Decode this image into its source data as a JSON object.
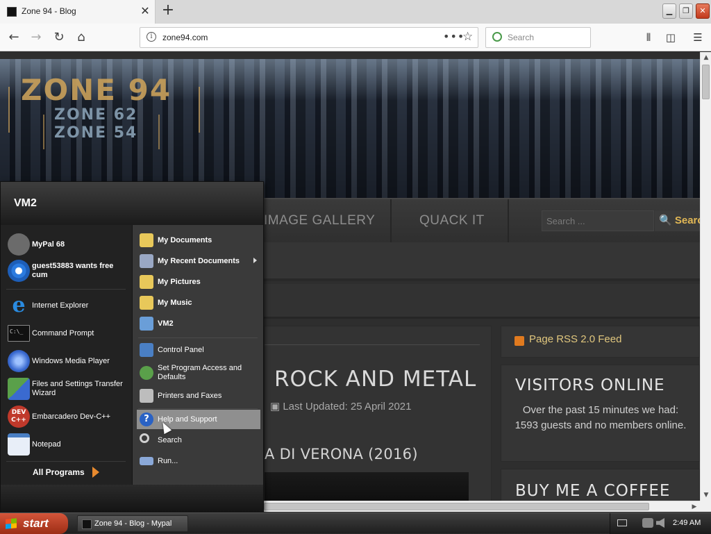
{
  "browser": {
    "tab_title": "Zone 94 - Blog",
    "new_tab_symbol": "+",
    "url": "zone94.com",
    "search_placeholder": "Search",
    "url_actions": "•••",
    "bookmark_star": "☆"
  },
  "site": {
    "logo": {
      "main": "ZONE 94",
      "sub1": "ZONE 62",
      "sub2": "ZONE 54"
    },
    "menu": [
      "IMAGE GALLERY",
      "QUACK IT"
    ],
    "search_placeholder": "Search ...",
    "search_button": "Search",
    "article": {
      "title": "ROCK AND METAL",
      "date": "Last Updated: 25 April 2021",
      "subtitle": "A DI VERONA (2016)"
    },
    "sidebar": {
      "rss": "Page RSS 2.0 Feed",
      "visitors_heading": "VISITORS ONLINE",
      "visitors_text": "Over the past 15 minutes we had: 1593 guests and no members online.",
      "coffee_heading": "BUY ME A COFFEE"
    }
  },
  "start_menu": {
    "user": "VM2",
    "left_items": [
      {
        "label": "MyPal 68",
        "bold": true,
        "icon": "mypal-icon",
        "color": "#6b6b6b"
      },
      {
        "label": "guest53883 wants free cum",
        "bold": true,
        "icon": "chrome-icon",
        "color": "#2b7be0"
      },
      {
        "label": "Internet Explorer",
        "bold": false,
        "icon": "ie-icon",
        "color": "#2a8be0"
      },
      {
        "label": "Command Prompt",
        "bold": false,
        "icon": "cmd-icon",
        "color": "#111111"
      },
      {
        "label": "Windows Media Player",
        "bold": false,
        "icon": "media-player-icon",
        "color": "#3a6ad0"
      },
      {
        "label": "Files and Settings Transfer Wizard",
        "bold": false,
        "icon": "transfer-wizard-icon",
        "color": "#5aa04a"
      },
      {
        "label": "Embarcadero Dev-C++",
        "bold": false,
        "icon": "devcpp-icon",
        "color": "#c0392b"
      },
      {
        "label": "Notepad",
        "bold": false,
        "icon": "notepad-icon",
        "color": "#4a7fc4"
      }
    ],
    "all_programs": "All Programs",
    "right_items": [
      {
        "label": "My Documents",
        "bold": true,
        "icon": "folder-icon",
        "color": "#e8c85a"
      },
      {
        "label": "My Recent Documents",
        "bold": true,
        "icon": "recent-docs-icon",
        "color": "#9aa8c4",
        "arrow": true
      },
      {
        "label": "My Pictures",
        "bold": true,
        "icon": "pictures-folder-icon",
        "color": "#e8c85a"
      },
      {
        "label": "My Music",
        "bold": true,
        "icon": "music-folder-icon",
        "color": "#e8c85a"
      },
      {
        "label": "VM2",
        "bold": true,
        "icon": "computer-icon",
        "color": "#6a9ed8"
      },
      {
        "label": "Control Panel",
        "bold": false,
        "icon": "control-panel-icon",
        "color": "#4a7fc4"
      },
      {
        "label": "Set Program Access and Defaults",
        "bold": false,
        "icon": "program-defaults-icon",
        "color": "#5aa04a"
      },
      {
        "label": "Printers and Faxes",
        "bold": false,
        "icon": "printer-icon",
        "color": "#bdbdbd"
      },
      {
        "label": "Help and Support",
        "bold": false,
        "icon": "help-icon",
        "color": "#2a62c4",
        "highlight": true
      },
      {
        "label": "Search",
        "bold": false,
        "icon": "search-icon",
        "color": "#d0d0d0"
      },
      {
        "label": "Run...",
        "bold": false,
        "icon": "run-icon",
        "color": "#8aa8d8"
      }
    ]
  },
  "taskbar": {
    "start": "start",
    "task": "Zone 94 - Blog - Mypal",
    "clock": "2:49 AM"
  }
}
